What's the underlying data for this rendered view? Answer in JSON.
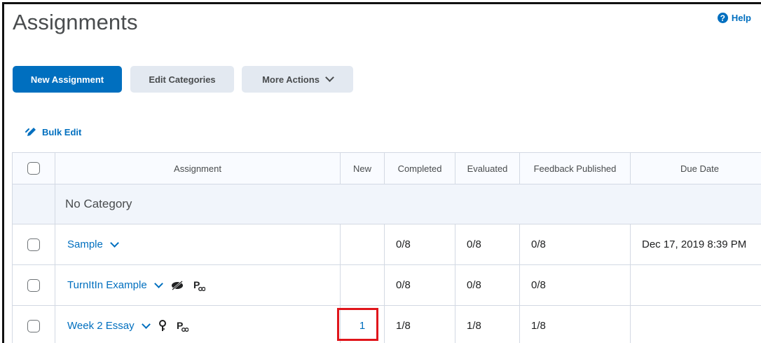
{
  "page": {
    "title": "Assignments",
    "help_label": "Help"
  },
  "toolbar": {
    "new_assignment": "New Assignment",
    "edit_categories": "Edit Categories",
    "more_actions": "More Actions"
  },
  "bulk_edit": "Bulk Edit",
  "table": {
    "headers": {
      "assignment": "Assignment",
      "new": "New",
      "completed": "Completed",
      "evaluated": "Evaluated",
      "feedback": "Feedback Published",
      "due": "Due Date"
    },
    "category": "No Category",
    "rows": [
      {
        "name": "Sample",
        "new": "",
        "completed": "0/8",
        "evaluated": "0/8",
        "feedback": "0/8",
        "due": "Dec 17, 2019 8:39 PM"
      },
      {
        "name": "TurnItIn Example",
        "new": "",
        "completed": "0/8",
        "evaluated": "0/8",
        "feedback": "0/8",
        "due": ""
      },
      {
        "name": "Week 2 Essay",
        "new": "1",
        "completed": "1/8",
        "evaluated": "1/8",
        "feedback": "1/8",
        "due": ""
      }
    ]
  },
  "colors": {
    "accent": "#006fbf",
    "highlight": "#e0151b"
  }
}
